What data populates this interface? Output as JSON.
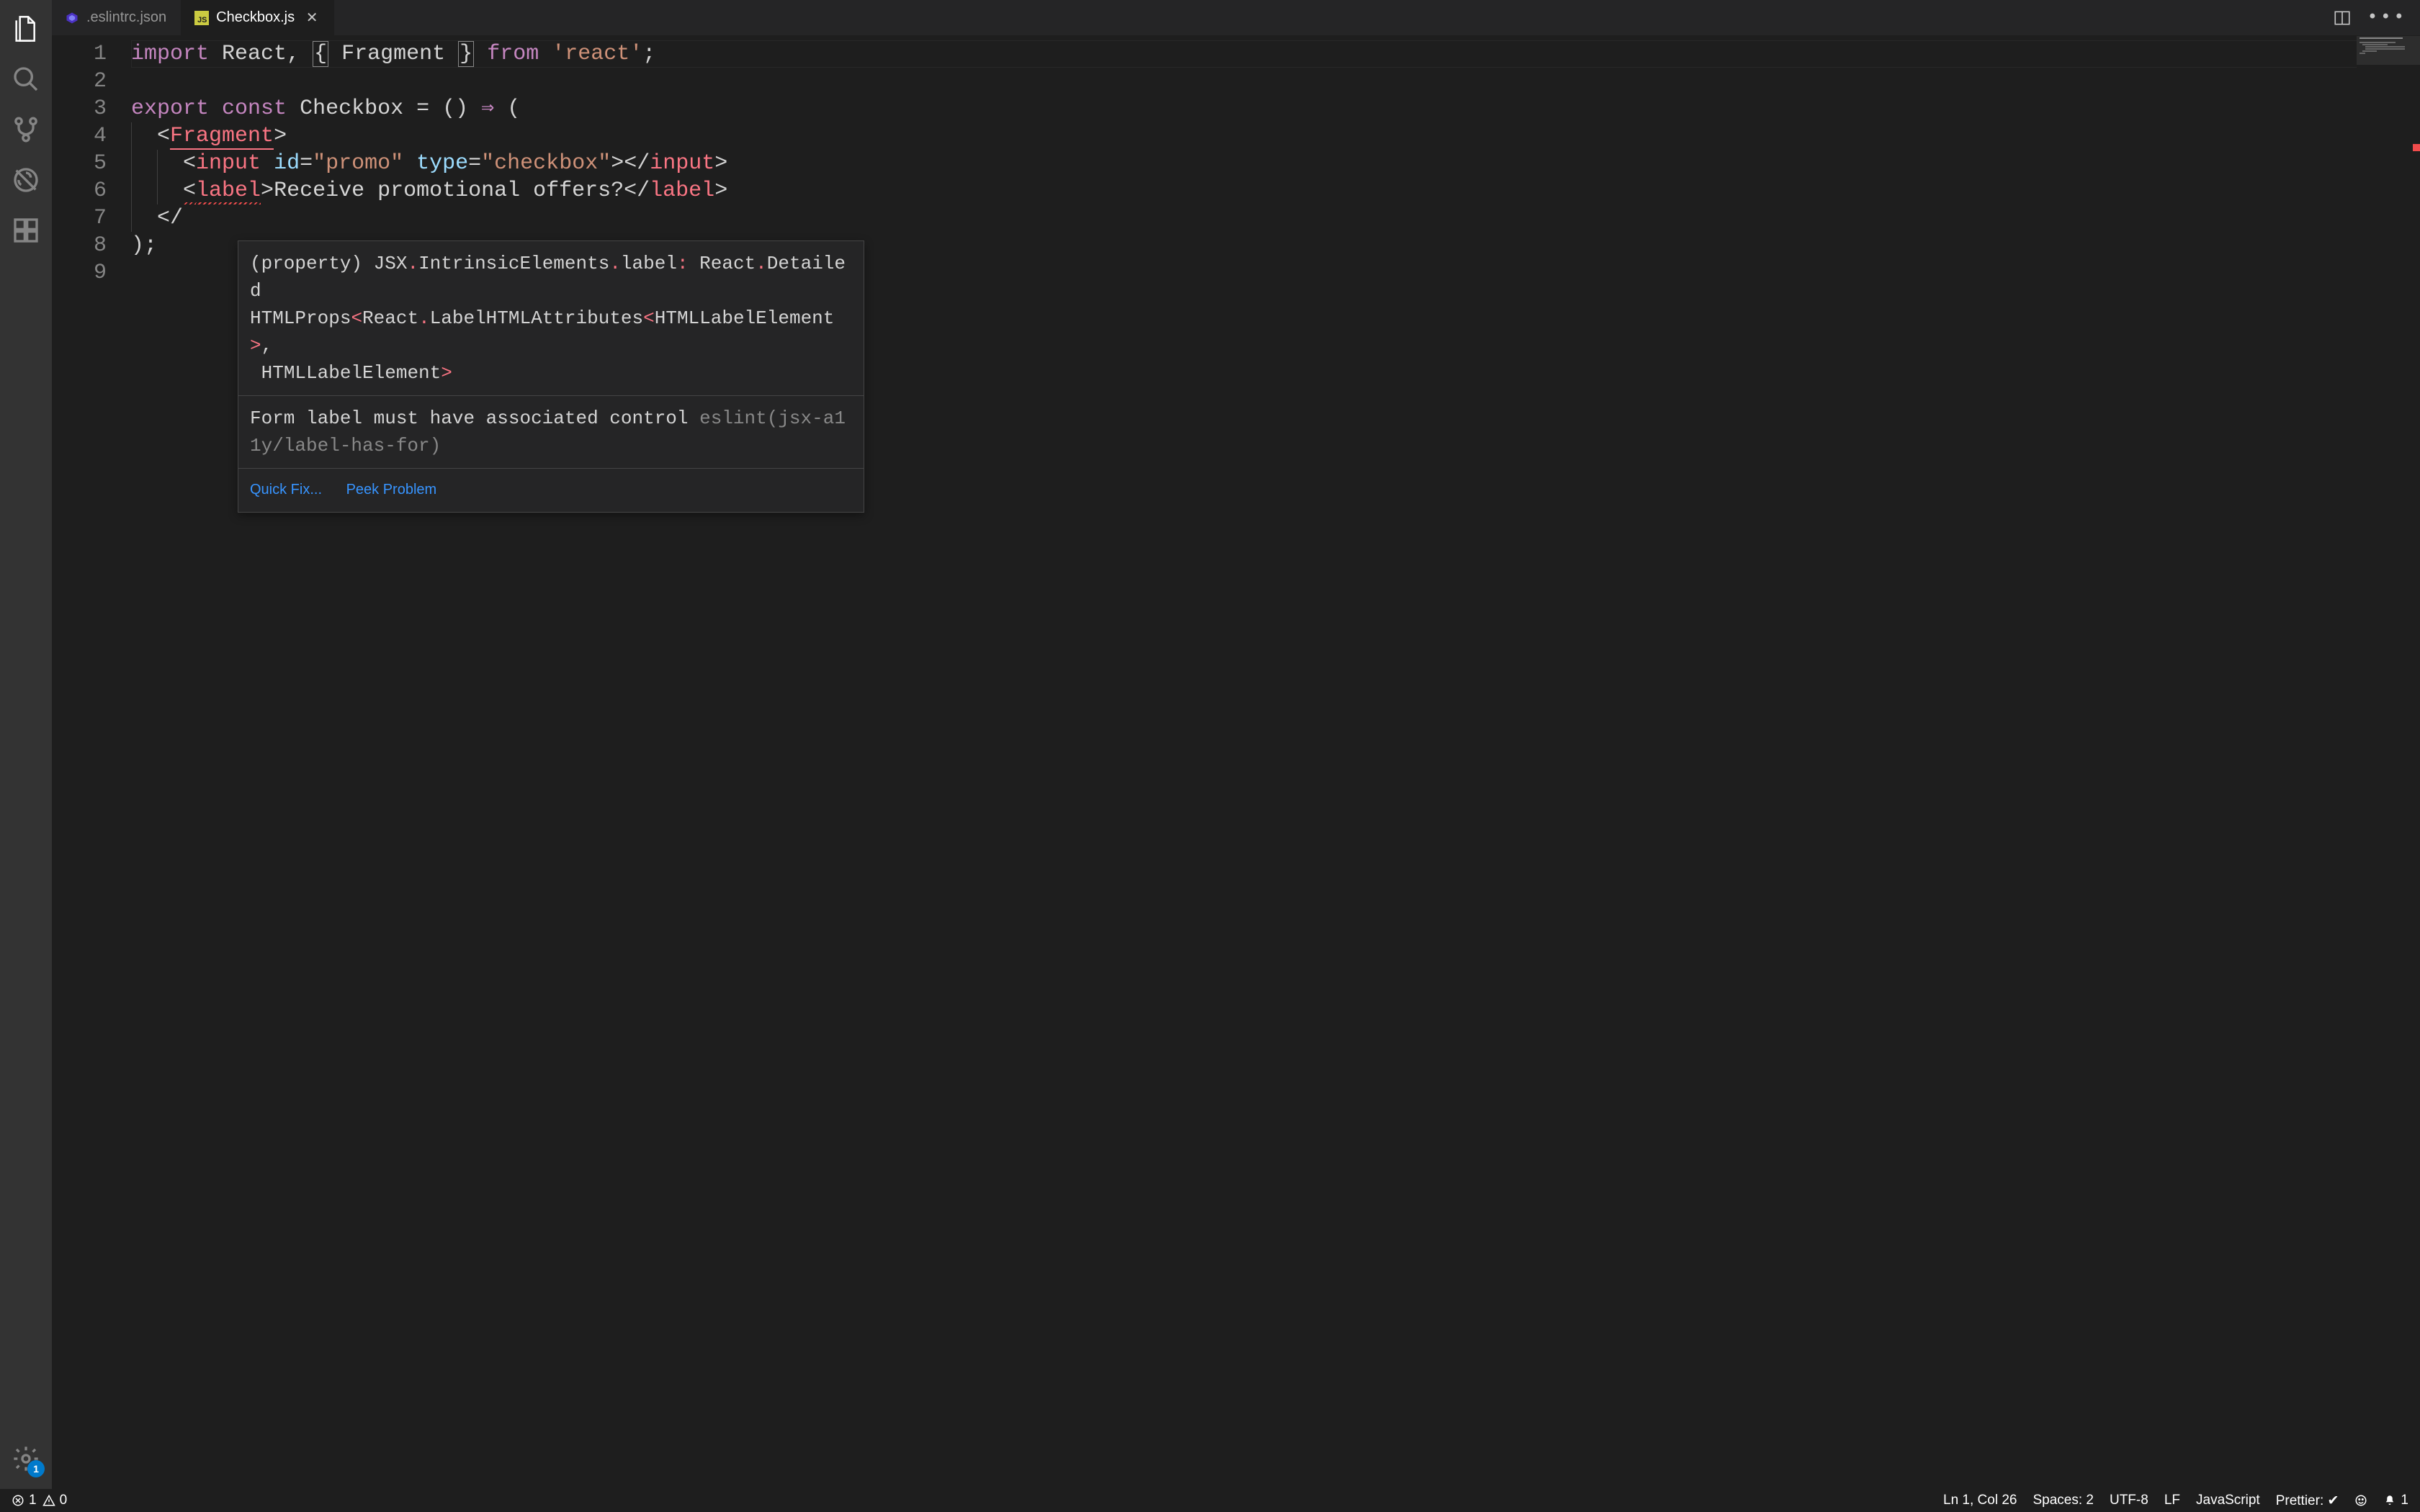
{
  "activitybar": {
    "update_badge": "1"
  },
  "tabs": [
    {
      "icon": "eslint",
      "label": ".eslintrc.json",
      "active": false
    },
    {
      "icon": "js",
      "label": "Checkbox.js",
      "active": true
    }
  ],
  "editor": {
    "lines": [
      {
        "n": 1,
        "tokens": [
          {
            "t": "import",
            "c": "kw"
          },
          {
            "t": " ",
            "c": ""
          },
          {
            "t": "React",
            "c": "id"
          },
          {
            "t": ", ",
            "c": "punc"
          },
          {
            "t": "{",
            "c": "bracket-box"
          },
          {
            "t": " ",
            "c": ""
          },
          {
            "t": "Fragment",
            "c": "id"
          },
          {
            "t": " ",
            "c": ""
          },
          {
            "t": "}",
            "c": "bracket-box"
          },
          {
            "t": " ",
            "c": ""
          },
          {
            "t": "from",
            "c": "kw"
          },
          {
            "t": " ",
            "c": ""
          },
          {
            "t": "'react'",
            "c": "str"
          },
          {
            "t": ";",
            "c": "punc"
          }
        ],
        "hl": true
      },
      {
        "n": 2,
        "tokens": []
      },
      {
        "n": 3,
        "tokens": [
          {
            "t": "export",
            "c": "kw"
          },
          {
            "t": " ",
            "c": ""
          },
          {
            "t": "const",
            "c": "kw"
          },
          {
            "t": " ",
            "c": ""
          },
          {
            "t": "Checkbox",
            "c": "id"
          },
          {
            "t": " = () ",
            "c": "punc"
          },
          {
            "t": "⇒",
            "c": "kw"
          },
          {
            "t": " (",
            "c": "punc"
          }
        ]
      },
      {
        "n": 4,
        "tokens": [
          {
            "t": "  ",
            "c": ""
          },
          {
            "t": "<",
            "c": "punc"
          },
          {
            "t": "Fragment",
            "c": "frag"
          },
          {
            "t": ">",
            "c": "punc"
          }
        ]
      },
      {
        "n": 5,
        "tokens": [
          {
            "t": "    ",
            "c": ""
          },
          {
            "t": "<",
            "c": "punc"
          },
          {
            "t": "input",
            "c": "tag"
          },
          {
            "t": " ",
            "c": ""
          },
          {
            "t": "id",
            "c": "attr"
          },
          {
            "t": "=",
            "c": "punc"
          },
          {
            "t": "\"promo\"",
            "c": "str"
          },
          {
            "t": " ",
            "c": ""
          },
          {
            "t": "type",
            "c": "attr"
          },
          {
            "t": "=",
            "c": "punc"
          },
          {
            "t": "\"checkbox\"",
            "c": "str"
          },
          {
            "t": "></",
            "c": "punc"
          },
          {
            "t": "input",
            "c": "tag"
          },
          {
            "t": ">",
            "c": "punc"
          }
        ]
      },
      {
        "n": 6,
        "tokens": [
          {
            "t": "    ",
            "c": ""
          },
          {
            "t": "<",
            "c": "punc err"
          },
          {
            "t": "label",
            "c": "tag err"
          },
          {
            "t": ">",
            "c": "punc"
          },
          {
            "t": "Receive promotional offers?",
            "c": "id"
          },
          {
            "t": "</",
            "c": "punc"
          },
          {
            "t": "label",
            "c": "tag"
          },
          {
            "t": ">",
            "c": "punc"
          }
        ]
      },
      {
        "n": 7,
        "tokens": [
          {
            "t": "  ",
            "c": ""
          },
          {
            "t": "</",
            "c": "punc"
          }
        ]
      },
      {
        "n": 8,
        "tokens": [
          {
            "t": ");",
            "c": "punc"
          }
        ]
      },
      {
        "n": 9,
        "tokens": []
      }
    ]
  },
  "hover": {
    "sig_tokens": [
      {
        "t": "(property) ",
        "c": "hv-type"
      },
      {
        "t": "JSX",
        "c": "hv-type"
      },
      {
        "t": ".",
        "c": "hv-dot"
      },
      {
        "t": "IntrinsicElements",
        "c": "hv-type"
      },
      {
        "t": ".",
        "c": "hv-dot"
      },
      {
        "t": "label",
        "c": "hv-type"
      },
      {
        "t": ":",
        "c": "hv-dot"
      },
      {
        "t": " React",
        "c": "hv-type"
      },
      {
        "t": ".",
        "c": "hv-dot"
      },
      {
        "t": "Detailed\nHTMLProps",
        "c": "hv-type"
      },
      {
        "t": "<",
        "c": "hv-dot"
      },
      {
        "t": "React",
        "c": "hv-type"
      },
      {
        "t": ".",
        "c": "hv-dot"
      },
      {
        "t": "LabelHTMLAttributes",
        "c": "hv-type"
      },
      {
        "t": "<",
        "c": "hv-dot"
      },
      {
        "t": "HTMLLabelElement",
        "c": "hv-type"
      },
      {
        "t": ">",
        "c": "hv-dot"
      },
      {
        "t": ",\n HTMLLabelElement",
        "c": "hv-type"
      },
      {
        "t": ">",
        "c": "hv-dot"
      }
    ],
    "message": "Form label must have associated control ",
    "rule": "eslint(jsx-a11y/label-has-for)",
    "actions": {
      "quickfix": "Quick Fix...",
      "peek": "Peek Problem"
    }
  },
  "status": {
    "errors": "1",
    "warnings": "0",
    "cursor": "Ln 1, Col 26",
    "spaces": "Spaces: 2",
    "encoding": "UTF-8",
    "eol": "LF",
    "lang": "JavaScript",
    "prettier": "Prettier: ✔",
    "bell": "1"
  }
}
